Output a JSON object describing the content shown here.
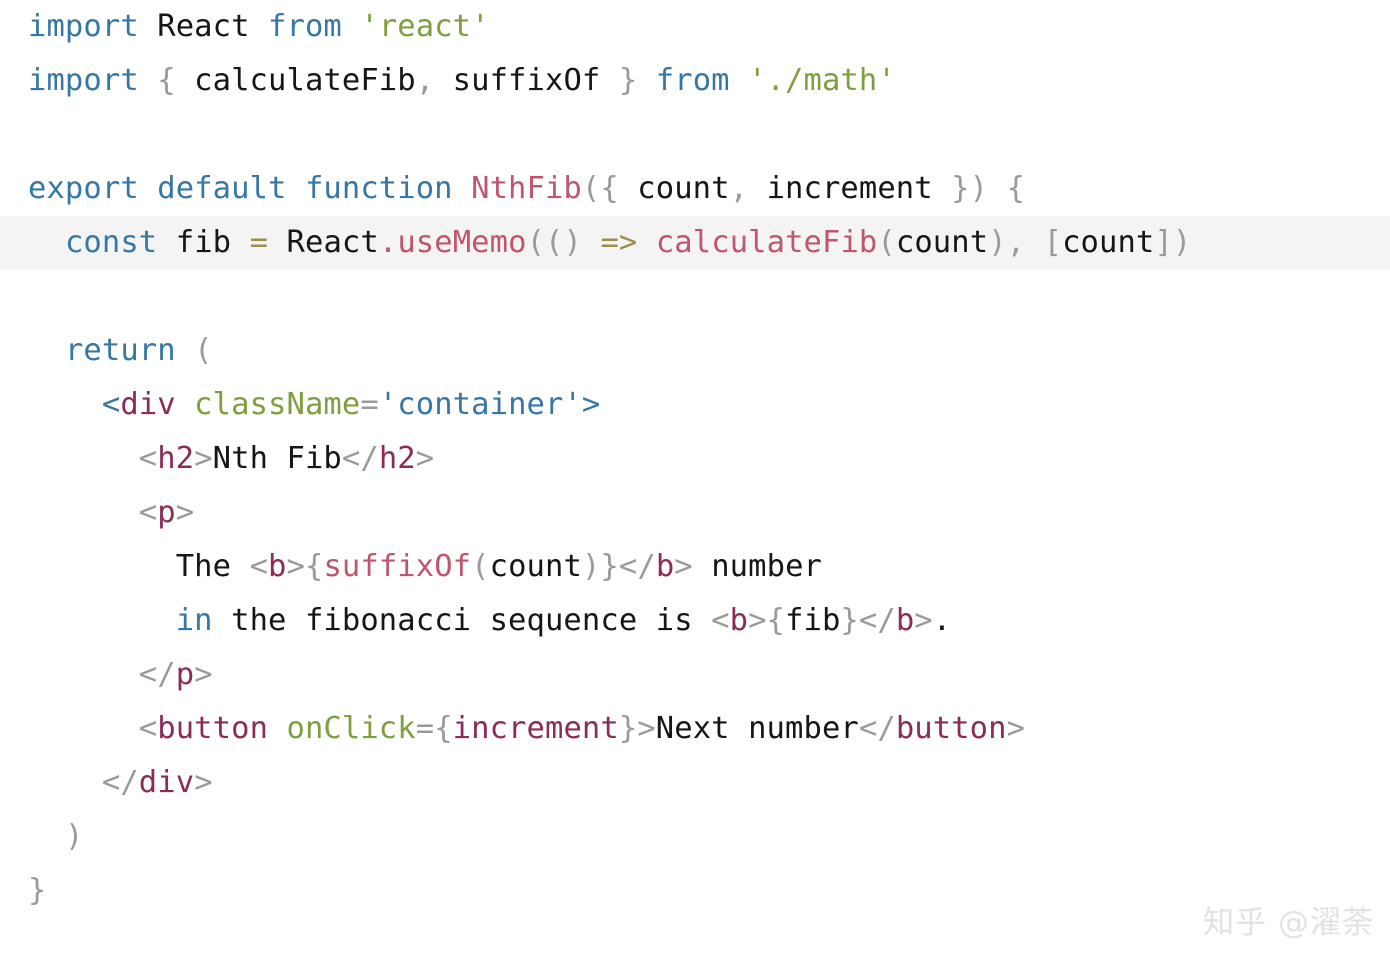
{
  "editor": {
    "language": "jsx",
    "background_color": "#ffffff",
    "highlight_line_color": "#f4f4f4",
    "palette": {
      "keyword": "#3777a6",
      "string": "#7f9f3f",
      "function": "#c0566e",
      "tag": "#8b2b57",
      "attribute": "#7f9f3f",
      "punctuation": "#9a9a9a",
      "operator": "#9c8f4e",
      "text": "#161616"
    },
    "highlighted_line_number": 5
  },
  "code": {
    "line1": {
      "kw_import": "import",
      "name_react": " React ",
      "kw_from": "from",
      "str_react": " 'react'"
    },
    "line2": {
      "kw_import": "import",
      "brace_open": " { ",
      "name_calculateFib": "calculateFib",
      "comma": ", ",
      "name_suffixOf": "suffixOf",
      "brace_close": " } ",
      "kw_from": "from",
      "str_math": " './math'"
    },
    "line3": {
      "blank": ""
    },
    "line4": {
      "kw_export": "export",
      "kw_default": " default",
      "kw_function": " function",
      "fn_name": " NthFib",
      "punc_paren_brace": "({ ",
      "param_count": "count",
      "punc_comma": ", ",
      "param_increment": "increment",
      "punc_close": " }) {"
    },
    "line5": {
      "indent": "  ",
      "kw_const": "const",
      "name_fib": " fib ",
      "op_assign": "=",
      "name_react": " React",
      "punc_dot": ".",
      "fn_useMemo": "useMemo",
      "punc_open": "((",
      "punc_close_paren": ") ",
      "op_arrow": "=>",
      "fn_calculateFib": " calculateFib",
      "punc_open2": "(",
      "arg_count": "count",
      "punc_close2": ")",
      "punc_comma": ", ",
      "punc_bracket_open": "[",
      "dep_count": "count",
      "punc_tail": "])"
    },
    "line6": {
      "blank": ""
    },
    "line7": {
      "indent": "  ",
      "kw_return": "return",
      "punc_paren": " ("
    },
    "line8": {
      "indent": "    ",
      "angle_open": "<",
      "tag_div": "div",
      "attr_className": " className",
      "eq": "=",
      "attr_value": "'container'",
      "angle_close": ">"
    },
    "line9": {
      "indent": "      ",
      "angle_open": "<",
      "tag_h2": "h2",
      "angle_close": ">",
      "text": "Nth Fib",
      "angle_close_open": "</",
      "tag_h2_close": "h2",
      "angle_end": ">"
    },
    "line10": {
      "indent": "      ",
      "angle_open": "<",
      "tag_p": "p",
      "angle_close": ">"
    },
    "line11": {
      "indent": "        ",
      "text_the": "The ",
      "angle_open": "<",
      "tag_b": "b",
      "angle_close": ">",
      "brace_open": "{",
      "fn_suffixOf": "suffixOf",
      "paren_open": "(",
      "arg_count": "count",
      "paren_close": ")",
      "brace_close": "}",
      "angle_close_open": "</",
      "tag_b_close": "b",
      "angle_end": ">",
      "text_number": " number"
    },
    "line12": {
      "indent": "        ",
      "kw_in": "in",
      "text_mid": " the fibonacci sequence is ",
      "angle_open": "<",
      "tag_b": "b",
      "angle_close": ">",
      "brace_open": "{",
      "var_fib": "fib",
      "brace_close": "}",
      "angle_close_open": "</",
      "tag_b_close": "b",
      "angle_end": ">",
      "period": "."
    },
    "line13": {
      "indent": "      ",
      "angle_close_open": "</",
      "tag_p": "p",
      "angle_end": ">"
    },
    "line14": {
      "indent": "      ",
      "angle_open": "<",
      "tag_button": "button",
      "attr_onClick": " onClick",
      "eq": "=",
      "brace_open": "{",
      "handler_increment": "increment",
      "brace_close": "}",
      "angle_close": ">",
      "text_label": "Next number",
      "angle_close_open": "</",
      "tag_button_close": "button",
      "angle_end": ">"
    },
    "line15": {
      "indent": "    ",
      "angle_close_open": "</",
      "tag_div": "div",
      "angle_end": ">"
    },
    "line16": {
      "indent": "  ",
      "punc_paren": ")"
    },
    "line17": {
      "punc_brace": "}"
    }
  },
  "watermark": {
    "text": "知乎 @濯荼",
    "color": "#e2e2e2"
  }
}
